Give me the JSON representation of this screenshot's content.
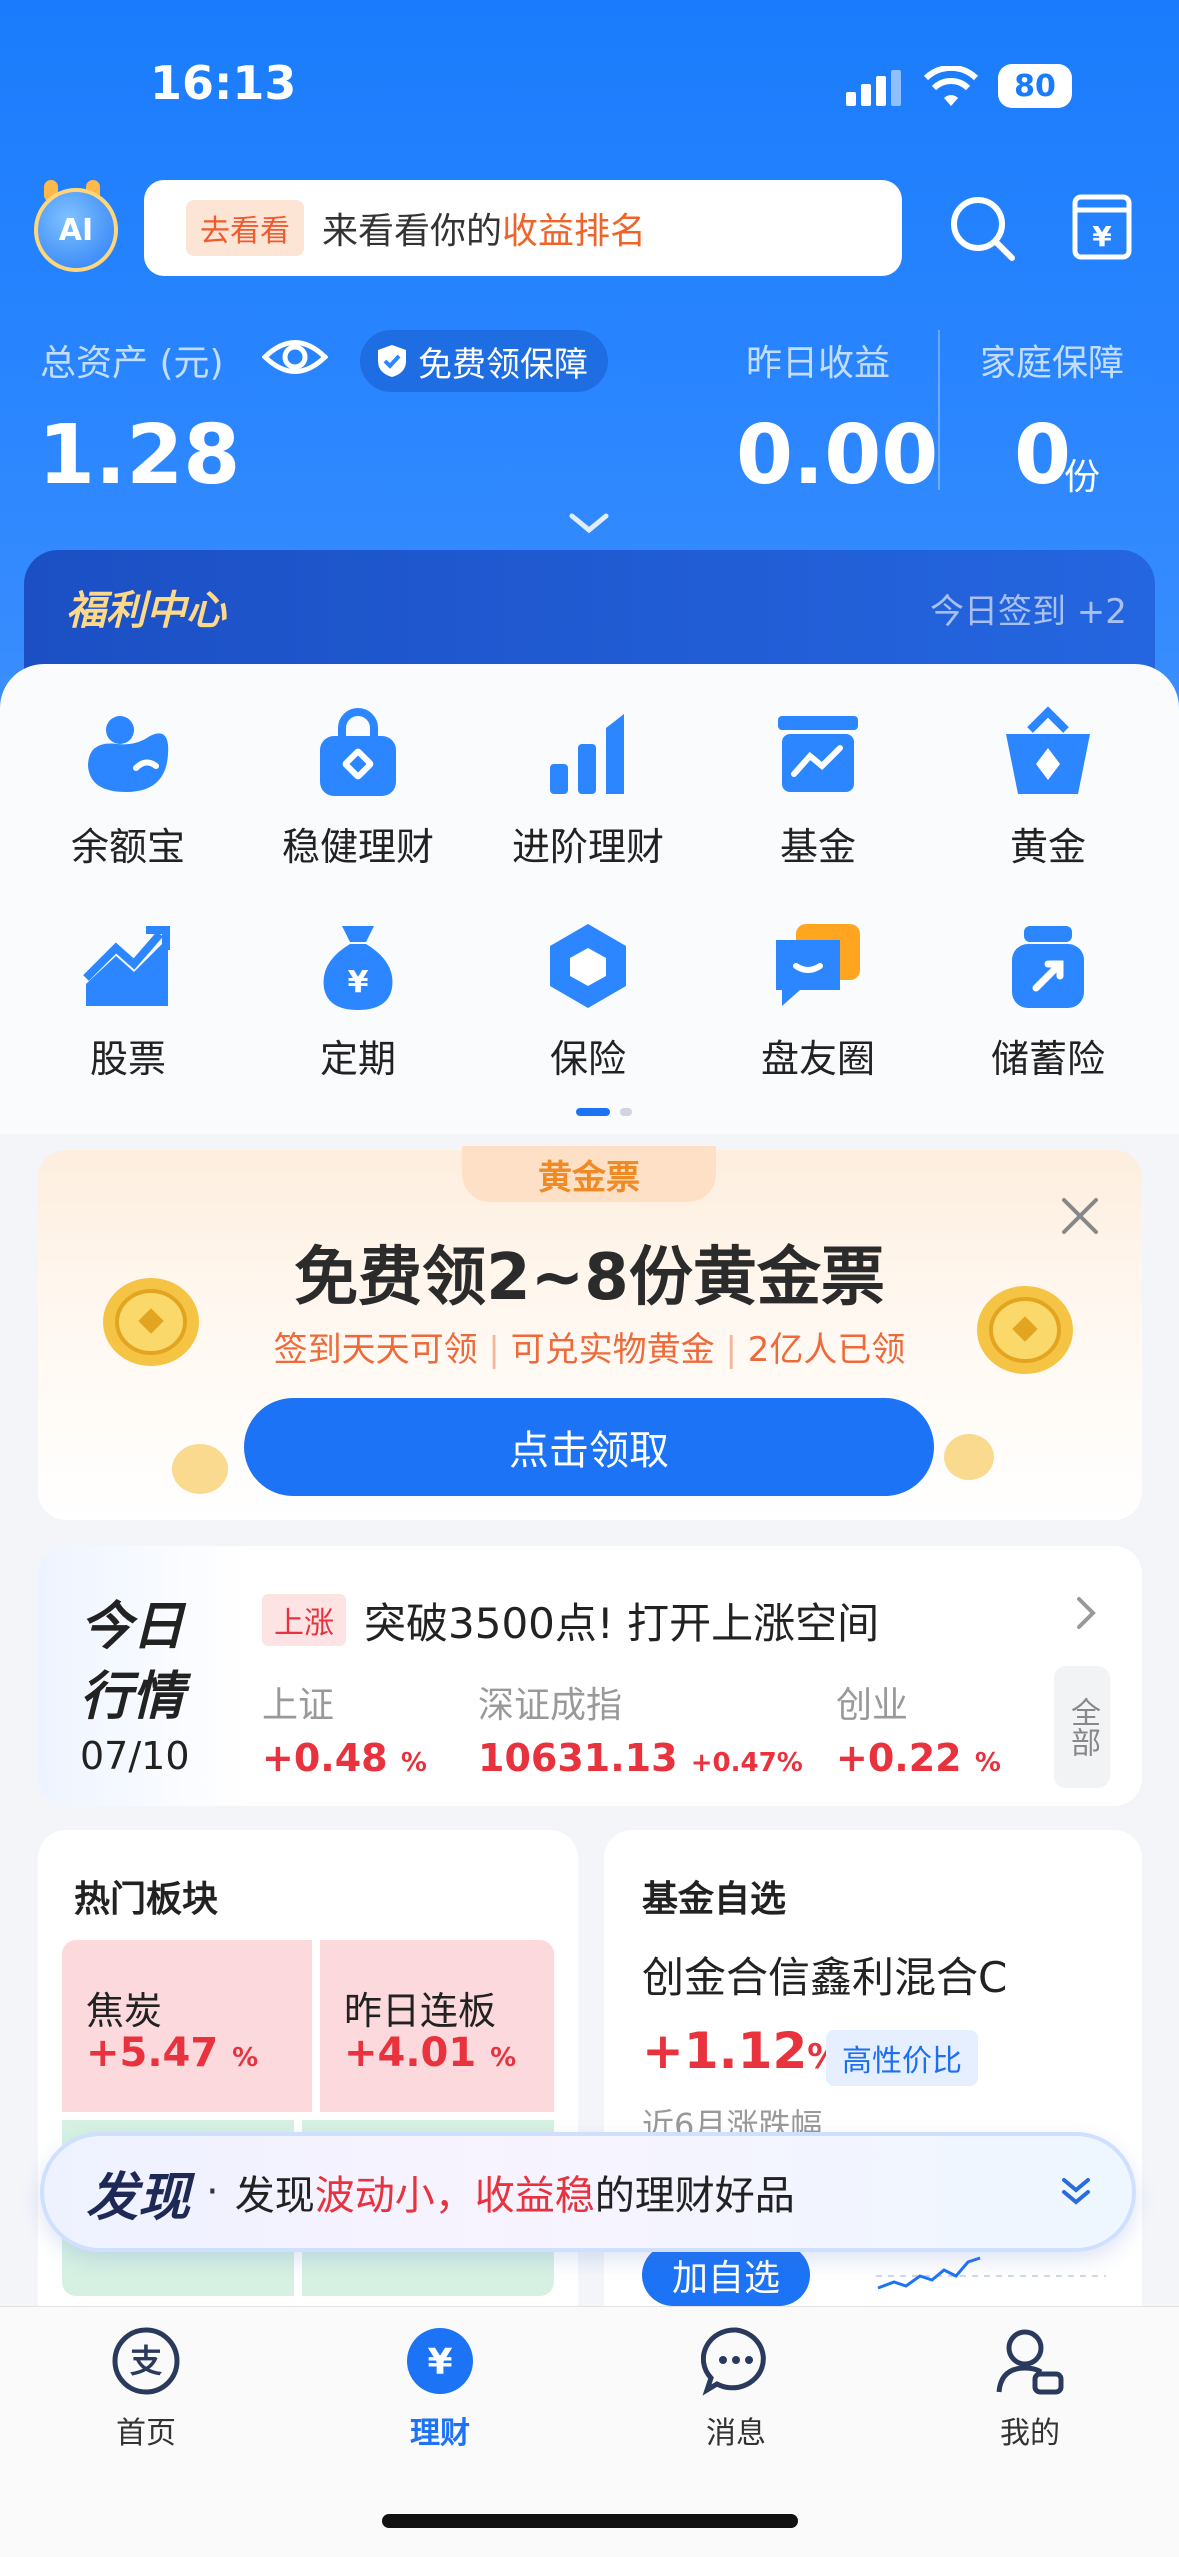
{
  "status_bar": {
    "time": "16:13",
    "battery": "80"
  },
  "header": {
    "ai_badge": "AI",
    "search_tag": "去看看",
    "search_prefix": "来看看你的",
    "search_highlight": "收益排名",
    "search_icon": "search-icon",
    "bill_icon": "bill-icon"
  },
  "assets": {
    "total_label": "总资产 (元)",
    "free_guarantee": "免费领保障",
    "total_value": "1.28",
    "yesterday_label": "昨日收益",
    "yesterday_value": "0.00",
    "family_label": "家庭保障",
    "family_value": "0",
    "family_unit": "份"
  },
  "welfare": {
    "title": "福利中心",
    "checkin": "今日签到 +2"
  },
  "grid": [
    {
      "label": "余额宝",
      "icon": "yuebao-icon"
    },
    {
      "label": "稳健理财",
      "icon": "bag-icon"
    },
    {
      "label": "进阶理财",
      "icon": "bars-icon"
    },
    {
      "label": "基金",
      "icon": "fund-icon"
    },
    {
      "label": "黄金",
      "icon": "gold-basket-icon"
    },
    {
      "label": "股票",
      "icon": "stock-icon"
    },
    {
      "label": "定期",
      "icon": "money-bag-icon"
    },
    {
      "label": "保险",
      "icon": "shield-icon"
    },
    {
      "label": "盘友圈",
      "icon": "chat-icon"
    },
    {
      "label": "储蓄险",
      "icon": "savings-icon"
    }
  ],
  "gold_promo": {
    "tag": "黄金票",
    "title": "免费领2~8份黄金票",
    "subtitle_1": "签到天天可领",
    "subtitle_2": "可兑实物黄金",
    "subtitle_3": "2亿人已领",
    "cta": "点击领取"
  },
  "market": {
    "title_1": "今日",
    "title_2": "行情",
    "date": "07/10",
    "badge": "上涨",
    "headline": "突破3500点! 打开上涨空间",
    "indices": [
      {
        "name": "上证",
        "value": "+0.48",
        "unit": "%"
      },
      {
        "name": "深证成指",
        "value": "10631.13",
        "sub": "+0.47%"
      },
      {
        "name": "创业",
        "value": "+0.22",
        "unit": "%"
      }
    ],
    "all_button": "全部"
  },
  "hot_sectors": {
    "title": "热门板块",
    "cells": [
      {
        "name": "焦炭",
        "value": "+5.47",
        "unit": "%"
      },
      {
        "name": "昨日连板",
        "value": "+4.01",
        "unit": "%"
      }
    ]
  },
  "fund_pick": {
    "title": "基金自选",
    "name": "创金合信鑫利混合C",
    "value": "+1.12",
    "unit": "%",
    "tag": "高性价比",
    "caption": "近6月涨跌幅",
    "add_button": "加自选"
  },
  "discover": {
    "label": "发现",
    "dot": "·",
    "prefix": "发现",
    "hl1": "波动小",
    "comma": "，",
    "hl2": "收益稳",
    "suffix": "的理财好品"
  },
  "tabbar": [
    {
      "label": "首页",
      "icon": "alipay-icon",
      "active": false
    },
    {
      "label": "理财",
      "icon": "yen-icon",
      "active": true
    },
    {
      "label": "消息",
      "icon": "message-icon",
      "active": false
    },
    {
      "label": "我的",
      "icon": "profile-icon",
      "active": false
    }
  ],
  "colors": {
    "primary": "#1c73f6",
    "rise": "#e8323d",
    "header": "#1a7cfc"
  }
}
